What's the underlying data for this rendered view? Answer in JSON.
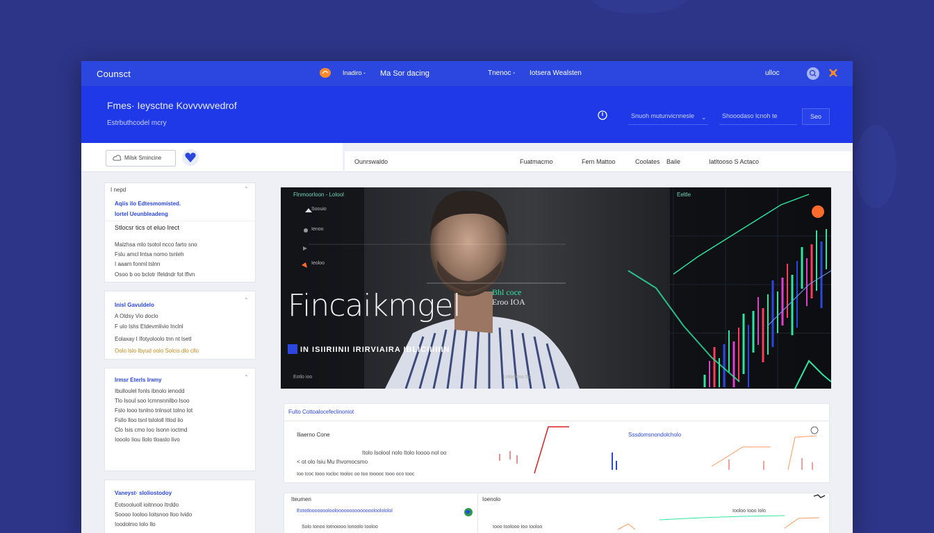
{
  "topbar": {
    "brand": "Counsct",
    "nav1": "Inadiro -",
    "nav2": "Ma Sor dacing",
    "nav3": "Tnenoc -",
    "nav4": "Iotsera Wealsten",
    "user": "ulloc"
  },
  "hero": {
    "title": "Fmes· Ieysctne Kovvvwvedrof",
    "subtitle": "Estrbuthcodel mcry",
    "search1_placeholder": "Snuoh mutunvicnnesle",
    "search2_placeholder": "Shooodaso lcnoh te",
    "search_button": "Seo"
  },
  "subbar": {
    "pill_label": "Milsk Smincine",
    "tabs": [
      "Ounrswaldo",
      "Fuatmacmo",
      "Fern Mattoo",
      "Coolates",
      "Baile",
      "Iatltooso S Actaco"
    ]
  },
  "sidebar": {
    "cards": [
      {
        "header": "I nepd",
        "heading1": "Aqiis ilo Edtesmomisted.",
        "heading2": "Iortel Ueunbleadeng",
        "heading3": "Stlocsr tics ot eluo Irect",
        "lines": [
          "Malzhsa mlo tsotol ncco farto sno",
          "Fslu amcl Intsa nomo tsnleh",
          "I aaam fonml tslnn",
          "Osoo b oo bclotr Ifeldndr fot lflvn"
        ]
      },
      {
        "header": "Inisl Gavuldelo",
        "lines": [
          "A Oldsy Vio doclo",
          "F ulo Ishs Etdevmlivio Inclnl",
          "Eolaxay I Ifotyoloolo tnn nt lsetl",
          "Oolo lslo Ibyud oolo Solcis dlo cllo"
        ]
      },
      {
        "header": "Irmsr Eterls Irwny",
        "lines": [
          "Ibulloulel fonls ibnolo ienodd",
          "Tlo Isoul soo Icmnsnnilbo Isoo",
          "Fslo looo tsnlno tnlnsot tolno lot",
          "Fsllo lloo tsnl tslololl Itlod ilo",
          "Clo Isis cmo Ioo Isonn ioctmd",
          "Iooolo Iiou Ilolo tloaslo Iivo"
        ]
      },
      {
        "header": "Vaneyst· sloliostodoy",
        "lines": [
          "Eotsooluoll ioitnnoo Itrddo",
          "Soooo Iooloo Ioitsnoo lloo Ivido",
          "Ioodolmo Iolo Ilo"
        ]
      }
    ]
  },
  "feature": {
    "header_label": "Flnmoorloon - Lolool",
    "big_title": "Fincaikmgel",
    "price_line1": "Bhl coce",
    "price_line2": "Eroo IOA",
    "ticker": "IN ISIIRIINII IRIRVIAIRA IBLICIIIIIIN",
    "footer1": "Eotlo ioo",
    "footer2": "Lnloolooo bo",
    "chart_label": "Eeltle",
    "menu": [
      "Soouio",
      "Ienoo",
      "Ieoloo"
    ]
  },
  "panel1": {
    "title": "Fulto Cottoalocefeclinoniot",
    "row_label": "Iliaerno Cone",
    "row_label2": "Sssdomsnondolcholo",
    "info_line": "< ot olo Isiu Mu Ihvomocsmo",
    "info_right": "Itolo Isolool nolo Itolo Ioooo nol oo",
    "axis_text": "Ioo Icoc Iooo Iocloc Iooloc oo Ioo Iooooc Iooo oco Iooc"
  },
  "panel2": {
    "title": "Iteumen",
    "title2": "Ioenolo",
    "line1": "Eototloooooooloolooooooooooooooloolololol",
    "line2": "Solo Ionoo Iotnoiooo lonoolo Iooloo",
    "right_line": "Iooloo Iooo Iolo",
    "bottom": "Iooo Ioolooo Ioo Iooloo"
  },
  "colors": {
    "topbar": "#2b47e0",
    "hero_band": "#1f39e8",
    "accent_blue": "#2b47e0",
    "chart_green": "#2ee6a0",
    "chart_red": "#ff3b5c",
    "chart_pink": "#e040d0",
    "avatar_orange": "#ff6b2c"
  }
}
